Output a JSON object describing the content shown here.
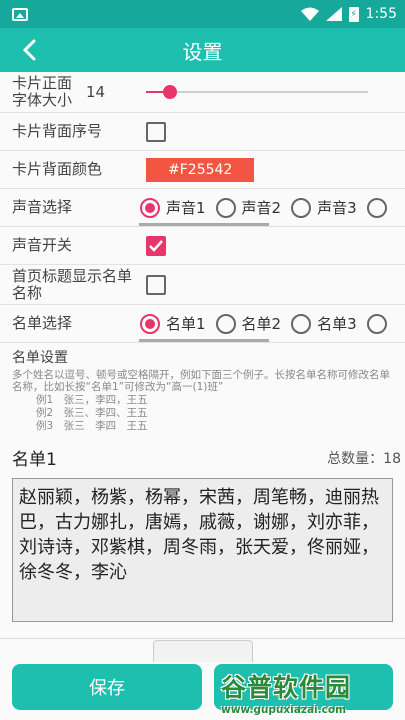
{
  "status": {
    "time": "1:55",
    "battery_glyph": "⚡"
  },
  "appbar": {
    "title": "设置"
  },
  "font_size": {
    "label": "卡片正面字体大小",
    "value": "14",
    "slider_fraction": 0.08
  },
  "back_index": {
    "label": "卡片背面序号",
    "checked": false
  },
  "back_color": {
    "label": "卡片背面颜色",
    "value": "#F25542",
    "color": "#F25542"
  },
  "sound_select": {
    "label": "声音选择",
    "options": [
      "声音1",
      "声音2",
      "声音3"
    ],
    "selected": 0
  },
  "sound_switch": {
    "label": "声音开关",
    "checked": true
  },
  "home_title": {
    "label": "首页标题显示名单名称",
    "checked": false
  },
  "list_select": {
    "label": "名单选择",
    "options": [
      "名单1",
      "名单2",
      "名单3"
    ],
    "selected": 0
  },
  "list_settings": {
    "title": "名单设置",
    "hint": "多个姓名以逗号、顿号或空格隔开，例如下面三个例子。长按名单名称可修改名单名称，比如长按“名单1”可修改为“高一(1)班”",
    "examples": [
      "例1　张三，李四，王五",
      "例2　张三、李四、王五",
      "例3　张三　李四　王五"
    ]
  },
  "current_list": {
    "name": "名单1",
    "count_label": "总数量：",
    "count": "18",
    "names": "赵丽颖，杨紫，杨幂，宋茜，周笔畅，迪丽热巴，古力娜扎，唐嫣，戚薇，谢娜，刘亦菲，刘诗诗，邓紫棋，周冬雨，张天爱，佟丽娅，徐冬冬，李沁"
  },
  "buttons": {
    "save": "保存"
  },
  "watermark": {
    "main": "谷普软件园",
    "url": "www.gupuxiazai.com"
  },
  "colors": {
    "accent": "#1fbfb0",
    "status": "#16a89a",
    "pink": "#e8356b"
  }
}
